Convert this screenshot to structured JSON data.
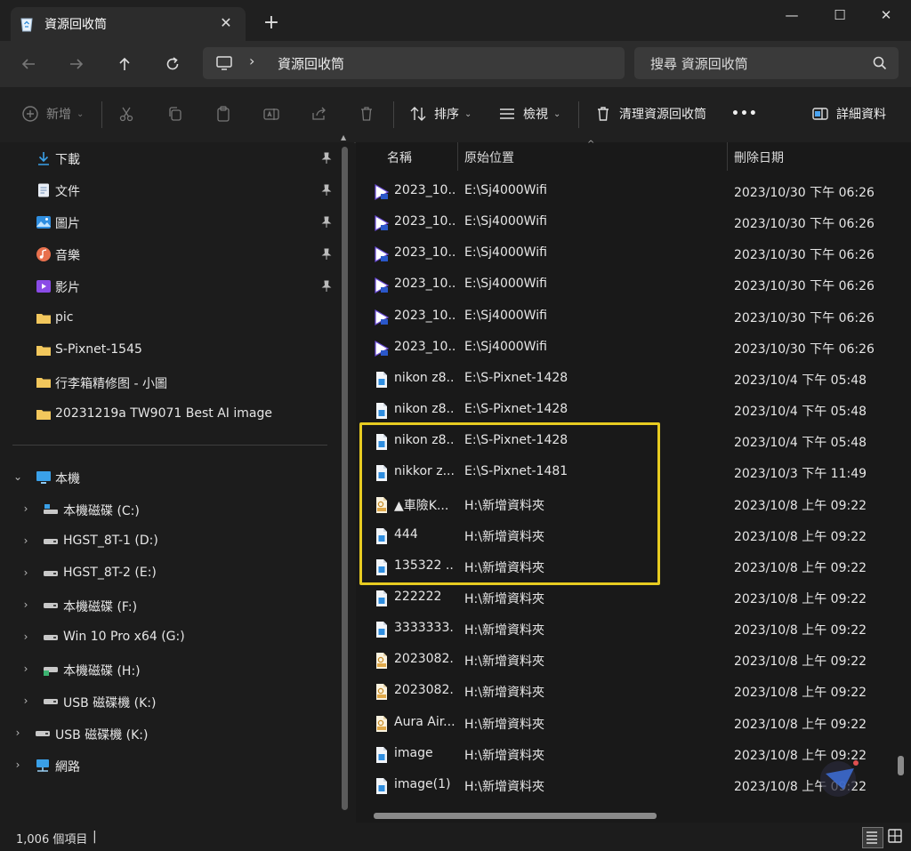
{
  "window": {
    "tab_title": "資源回收筒",
    "close_tab": "✕",
    "new_tab": "+",
    "minimize": "—",
    "maximize": "☐",
    "close": "✕"
  },
  "address": {
    "chevron": "›",
    "path": "資源回收筒",
    "search_placeholder": "搜尋 資源回收筒"
  },
  "toolbar": {
    "new_label": "新增",
    "sort_label": "排序",
    "view_label": "檢視",
    "empty_bin_label": "清理資源回收筒",
    "more_label": "•••",
    "details_label": "詳細資料",
    "dropdown_glyph": "⌄"
  },
  "nav": {
    "quick_access": [
      {
        "label": "下載",
        "icon": "download-icon",
        "pinned": true
      },
      {
        "label": "文件",
        "icon": "document-icon",
        "pinned": true
      },
      {
        "label": "圖片",
        "icon": "pictures-icon",
        "pinned": true
      },
      {
        "label": "音樂",
        "icon": "music-icon",
        "pinned": true
      },
      {
        "label": "影片",
        "icon": "video-icon",
        "pinned": true
      },
      {
        "label": "pic",
        "icon": "folder-icon",
        "pinned": false
      },
      {
        "label": "S-Pixnet-1545",
        "icon": "folder-icon",
        "pinned": false
      },
      {
        "label": "行李箱精修图 - 小圖",
        "icon": "folder-icon",
        "pinned": false
      },
      {
        "label": "20231219a TW9071 Best AI image",
        "icon": "folder-icon",
        "pinned": false
      }
    ],
    "this_pc": {
      "label": "本機",
      "chevron": "⌄"
    },
    "drives": [
      {
        "label": "本機磁碟 (C:)",
        "chevron": "›"
      },
      {
        "label": "HGST_8T-1 (D:)",
        "chevron": "›"
      },
      {
        "label": "HGST_8T-2 (E:)",
        "chevron": "›"
      },
      {
        "label": "本機磁碟 (F:)",
        "chevron": "›"
      },
      {
        "label": "Win 10 Pro x64 (G:)",
        "chevron": "›"
      },
      {
        "label": "本機磁碟 (H:)",
        "chevron": "›"
      },
      {
        "label": "USB 磁碟機 (K:)",
        "chevron": "›"
      }
    ],
    "extra": [
      {
        "label": "USB 磁碟機 (K:)",
        "chevron": "›"
      },
      {
        "label": "網路",
        "chevron": "›"
      }
    ]
  },
  "columns": {
    "name": "名稱",
    "location": "原始位置",
    "deleted": "刪除日期",
    "sort_glyph": "^"
  },
  "files": [
    {
      "name": "2023_10...",
      "location": "E:\\Sj4000Wifi",
      "deleted": "2023/10/30 下午 06:26",
      "type": "video"
    },
    {
      "name": "2023_10...",
      "location": "E:\\Sj4000Wifi",
      "deleted": "2023/10/30 下午 06:26",
      "type": "video"
    },
    {
      "name": "2023_10...",
      "location": "E:\\Sj4000Wifi",
      "deleted": "2023/10/30 下午 06:26",
      "type": "video"
    },
    {
      "name": "2023_10...",
      "location": "E:\\Sj4000Wifi",
      "deleted": "2023/10/30 下午 06:26",
      "type": "video"
    },
    {
      "name": "2023_10...",
      "location": "E:\\Sj4000Wifi",
      "deleted": "2023/10/30 下午 06:26",
      "type": "video"
    },
    {
      "name": "2023_10...",
      "location": "E:\\Sj4000Wifi",
      "deleted": "2023/10/30 下午 06:26",
      "type": "video"
    },
    {
      "name": "nikon z8...",
      "location": "E:\\S-Pixnet-1428",
      "deleted": "2023/10/4 下午 05:48",
      "type": "image"
    },
    {
      "name": "nikon z8...",
      "location": "E:\\S-Pixnet-1428",
      "deleted": "2023/10/4 下午 05:48",
      "type": "image"
    },
    {
      "name": "nikon z8...",
      "location": "E:\\S-Pixnet-1428",
      "deleted": "2023/10/4 下午 05:48",
      "type": "image"
    },
    {
      "name": "nikkor z...",
      "location": "E:\\S-Pixnet-1481",
      "deleted": "2023/10/3 下午 11:49",
      "type": "image"
    },
    {
      "name": "▲車險K...",
      "location": "H:\\新增資料夾",
      "deleted": "2023/10/8 上午 09:22",
      "type": "pdf"
    },
    {
      "name": "444",
      "location": "H:\\新增資料夾",
      "deleted": "2023/10/8 上午 09:22",
      "type": "image"
    },
    {
      "name": "135322 ...",
      "location": "H:\\新增資料夾",
      "deleted": "2023/10/8 上午 09:22",
      "type": "image"
    },
    {
      "name": "222222",
      "location": "H:\\新增資料夾",
      "deleted": "2023/10/8 上午 09:22",
      "type": "image"
    },
    {
      "name": "3333333...",
      "location": "H:\\新增資料夾",
      "deleted": "2023/10/8 上午 09:22",
      "type": "image"
    },
    {
      "name": "2023082...",
      "location": "H:\\新增資料夾",
      "deleted": "2023/10/8 上午 09:22",
      "type": "pdf"
    },
    {
      "name": "2023082...",
      "location": "H:\\新增資料夾",
      "deleted": "2023/10/8 上午 09:22",
      "type": "pdf"
    },
    {
      "name": "Aura Air...",
      "location": "H:\\新增資料夾",
      "deleted": "2023/10/8 上午 09:22",
      "type": "pdf"
    },
    {
      "name": "image",
      "location": "H:\\新增資料夾",
      "deleted": "2023/10/8 上午 09:22",
      "type": "image"
    },
    {
      "name": "image(1)",
      "location": "H:\\新增資料夾",
      "deleted": "2023/10/8 上午 09:22",
      "type": "image"
    }
  ],
  "status": {
    "item_count": "1,006 個項目",
    "caret": "|"
  },
  "colors": {
    "highlight": "#e7cb21",
    "accent": "#4aa3f0",
    "folder": "#f2c75c"
  }
}
